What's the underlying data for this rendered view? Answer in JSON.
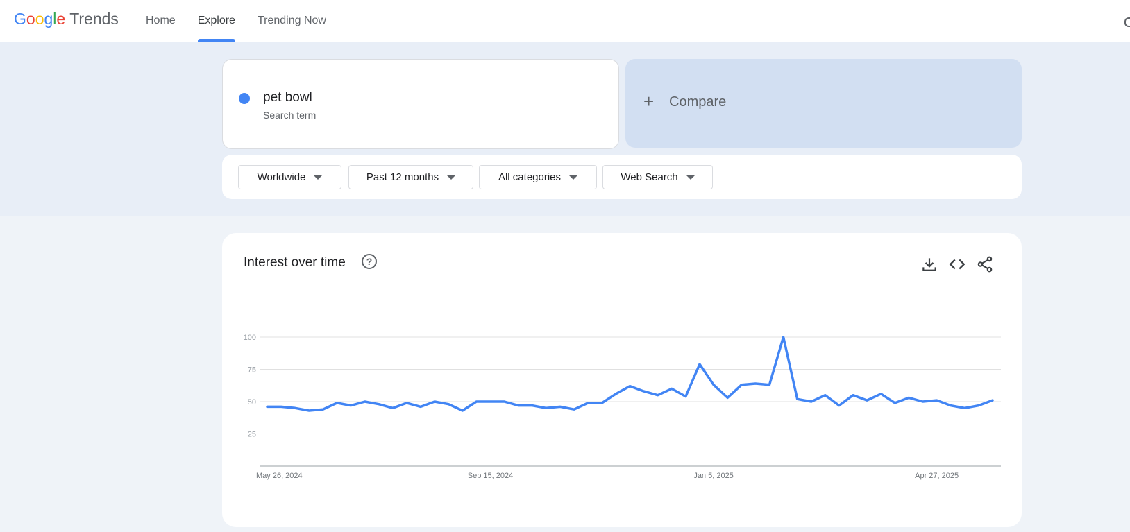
{
  "brand": {
    "google_letters": [
      {
        "ch": "G",
        "color": "#4285f4"
      },
      {
        "ch": "o",
        "color": "#ea4335"
      },
      {
        "ch": "o",
        "color": "#fbbc05"
      },
      {
        "ch": "g",
        "color": "#4285f4"
      },
      {
        "ch": "l",
        "color": "#34a853"
      },
      {
        "ch": "e",
        "color": "#ea4335"
      }
    ],
    "product": "Trends"
  },
  "nav": {
    "items": [
      {
        "label": "Home",
        "active": false
      },
      {
        "label": "Explore",
        "active": true
      },
      {
        "label": "Trending Now",
        "active": false
      }
    ]
  },
  "search_term": {
    "name": "pet bowl",
    "type": "Search term",
    "color": "#4285f4"
  },
  "compare": {
    "label": "Compare"
  },
  "filters": {
    "region": "Worldwide",
    "time": "Past 12 months",
    "category": "All categories",
    "property": "Web Search"
  },
  "chart": {
    "title": "Interest over time",
    "icons": [
      "help-icon",
      "download-icon",
      "embed-icon",
      "share-icon"
    ]
  },
  "chart_data": {
    "type": "line",
    "ylim": [
      0,
      100
    ],
    "yticks": [
      25,
      50,
      75,
      100
    ],
    "grid": true,
    "xtick_labels": [
      "May 26, 2024",
      "Sep 15, 2024",
      "Jan 5, 2025",
      "Apr 27, 2025"
    ],
    "xtick_indices": [
      0,
      16,
      32,
      48
    ],
    "series": [
      {
        "color": "#4285f4",
        "values": [
          46,
          46,
          45,
          43,
          44,
          49,
          47,
          50,
          48,
          45,
          49,
          46,
          50,
          48,
          43,
          50,
          50,
          50,
          47,
          47,
          45,
          46,
          44,
          49,
          49,
          56,
          62,
          58,
          55,
          60,
          54,
          79,
          63,
          53,
          63,
          64,
          63,
          100,
          52,
          50,
          55,
          47,
          55,
          51,
          56,
          49,
          53,
          50,
          51,
          47,
          45,
          47,
          51
        ]
      }
    ]
  }
}
